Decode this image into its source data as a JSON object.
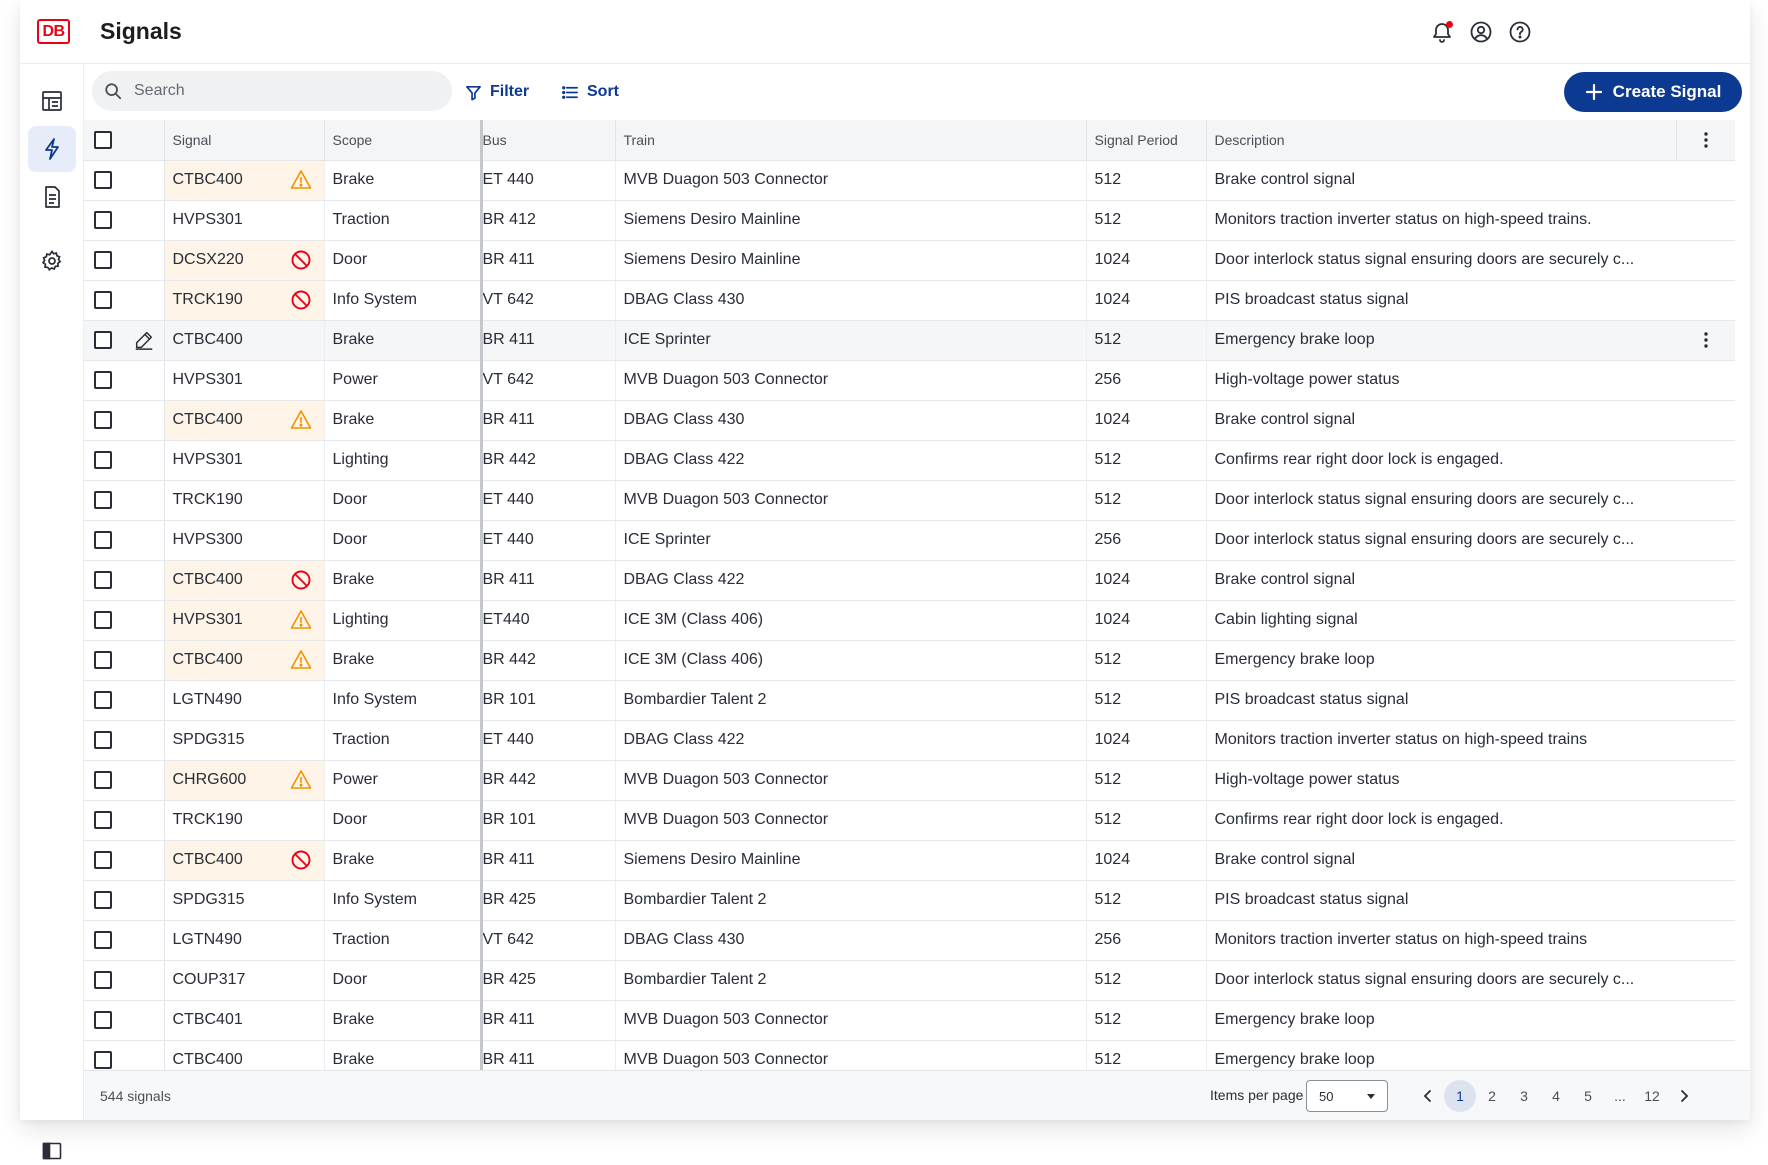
{
  "app": {
    "logo": "DB",
    "title": "Signals"
  },
  "header_icons": [
    "bell-icon",
    "user-circle-icon",
    "help-circle-icon"
  ],
  "sidebar": {
    "items": [
      {
        "name": "dashboard-icon",
        "active": false
      },
      {
        "name": "signal-bolt-icon",
        "active": true
      },
      {
        "name": "document-icon",
        "active": false
      },
      {
        "name": "settings-icon",
        "active": false
      }
    ]
  },
  "toolbar": {
    "search_placeholder": "Search",
    "filter_label": "Filter",
    "sort_label": "Sort",
    "create_label": "Create Signal"
  },
  "table": {
    "columns": [
      "Signal",
      "Scope",
      "Bus",
      "Train",
      "Signal Period",
      "Description"
    ],
    "rows": [
      {
        "signal": "CTBC400",
        "status": "warning",
        "scope": "Brake",
        "bus": "ET 440",
        "train": "MVB Duagon 503 Connector",
        "period": "512",
        "description": "Brake control signal"
      },
      {
        "signal": "HVPS301",
        "status": "",
        "scope": "Traction",
        "bus": "BR 412",
        "train": "Siemens Desiro Mainline",
        "period": "512",
        "description": "Monitors traction inverter status on high-speed trains."
      },
      {
        "signal": "DCSX220",
        "status": "error",
        "scope": "Door",
        "bus": "BR 411",
        "train": "Siemens Desiro Mainline",
        "period": "1024",
        "description": "Door interlock status signal ensuring doors are securely c..."
      },
      {
        "signal": "TRCK190",
        "status": "error",
        "scope": "Info System",
        "bus": "VT 642",
        "train": "DBAG Class 430",
        "period": "1024",
        "description": "PIS broadcast status signal"
      },
      {
        "signal": "CTBC400",
        "status": "edit",
        "scope": "Brake",
        "bus": "BR 411",
        "train": "ICE Sprinter",
        "period": "512",
        "description": "Emergency brake loop"
      },
      {
        "signal": "HVPS301",
        "status": "",
        "scope": "Power",
        "bus": "VT 642",
        "train": "MVB Duagon 503 Connector",
        "period": "256",
        "description": "High-voltage power status"
      },
      {
        "signal": "CTBC400",
        "status": "warning",
        "scope": "Brake",
        "bus": "BR 411",
        "train": "DBAG Class 430",
        "period": "1024",
        "description": "Brake control signal"
      },
      {
        "signal": "HVPS301",
        "status": "",
        "scope": "Lighting",
        "bus": "BR 442",
        "train": "DBAG Class 422",
        "period": "512",
        "description": "Confirms rear right door lock is engaged."
      },
      {
        "signal": "TRCK190",
        "status": "",
        "scope": "Door",
        "bus": "ET 440",
        "train": "MVB Duagon 503 Connector",
        "period": "512",
        "description": "Door interlock status signal ensuring doors are securely c..."
      },
      {
        "signal": "HVPS300",
        "status": "",
        "scope": "Door",
        "bus": "ET 440",
        "train": "ICE Sprinter",
        "period": "256",
        "description": "Door interlock status signal ensuring doors are securely c..."
      },
      {
        "signal": "CTBC400",
        "status": "error",
        "scope": "Brake",
        "bus": "BR 411",
        "train": "DBAG Class 422",
        "period": "1024",
        "description": "Brake control signal"
      },
      {
        "signal": "HVPS301",
        "status": "warning",
        "scope": "Lighting",
        "bus": "ET440",
        "train": "ICE 3M (Class 406)",
        "period": "1024",
        "description": "Cabin lighting signal"
      },
      {
        "signal": "CTBC400",
        "status": "warning",
        "scope": "Brake",
        "bus": "BR 442",
        "train": "ICE 3M (Class 406)",
        "period": "512",
        "description": "Emergency brake loop"
      },
      {
        "signal": "LGTN490",
        "status": "",
        "scope": "Info System",
        "bus": "BR 101",
        "train": "Bombardier Talent 2",
        "period": "512",
        "description": "PIS broadcast status signal"
      },
      {
        "signal": "SPDG315",
        "status": "",
        "scope": "Traction",
        "bus": "ET 440",
        "train": "DBAG Class 422",
        "period": "1024",
        "description": "Monitors traction inverter status on high-speed trains"
      },
      {
        "signal": "CHRG600",
        "status": "warning",
        "scope": "Power",
        "bus": "BR 442",
        "train": "MVB Duagon 503 Connector",
        "period": "512",
        "description": "High-voltage power status"
      },
      {
        "signal": "TRCK190",
        "status": "",
        "scope": "Door",
        "bus": "BR 101",
        "train": "MVB Duagon 503 Connector",
        "period": "512",
        "description": "Confirms rear right door lock is engaged."
      },
      {
        "signal": "CTBC400",
        "status": "error",
        "scope": "Brake",
        "bus": "BR 411",
        "train": "Siemens Desiro Mainline",
        "period": "1024",
        "description": "Brake control signal"
      },
      {
        "signal": "SPDG315",
        "status": "",
        "scope": "Info System",
        "bus": "BR 425",
        "train": "Bombardier Talent 2",
        "period": "512",
        "description": "PIS broadcast status signal"
      },
      {
        "signal": "LGTN490",
        "status": "",
        "scope": "Traction",
        "bus": "VT 642",
        "train": "DBAG Class 430",
        "period": "256",
        "description": "Monitors traction inverter status on high-speed trains"
      },
      {
        "signal": "COUP317",
        "status": "",
        "scope": "Door",
        "bus": "BR 425",
        "train": "Bombardier Talent 2",
        "period": "512",
        "description": "Door interlock status signal ensuring doors are securely c..."
      },
      {
        "signal": "CTBC401",
        "status": "",
        "scope": "Brake",
        "bus": "BR 411",
        "train": "MVB Duagon 503 Connector",
        "period": "512",
        "description": "Emergency brake loop"
      },
      {
        "signal": "CTBC400",
        "status": "",
        "scope": "Brake",
        "bus": "BR 411",
        "train": "MVB Duagon 503 Connector",
        "period": "512",
        "description": "Emergency brake loop"
      }
    ]
  },
  "footer": {
    "count": "544 signals",
    "items_per_page_label": "Items per page",
    "items_per_page_value": "50",
    "pages": [
      "1",
      "2",
      "3",
      "4",
      "5",
      "...",
      "12"
    ],
    "current_page": "1"
  },
  "colors": {
    "brand_red": "#ec0016",
    "primary_blue": "#0c3992",
    "warning_orange": "#f39200",
    "error_red": "#ec0016",
    "warning_row_bg": "#fff4e8"
  }
}
